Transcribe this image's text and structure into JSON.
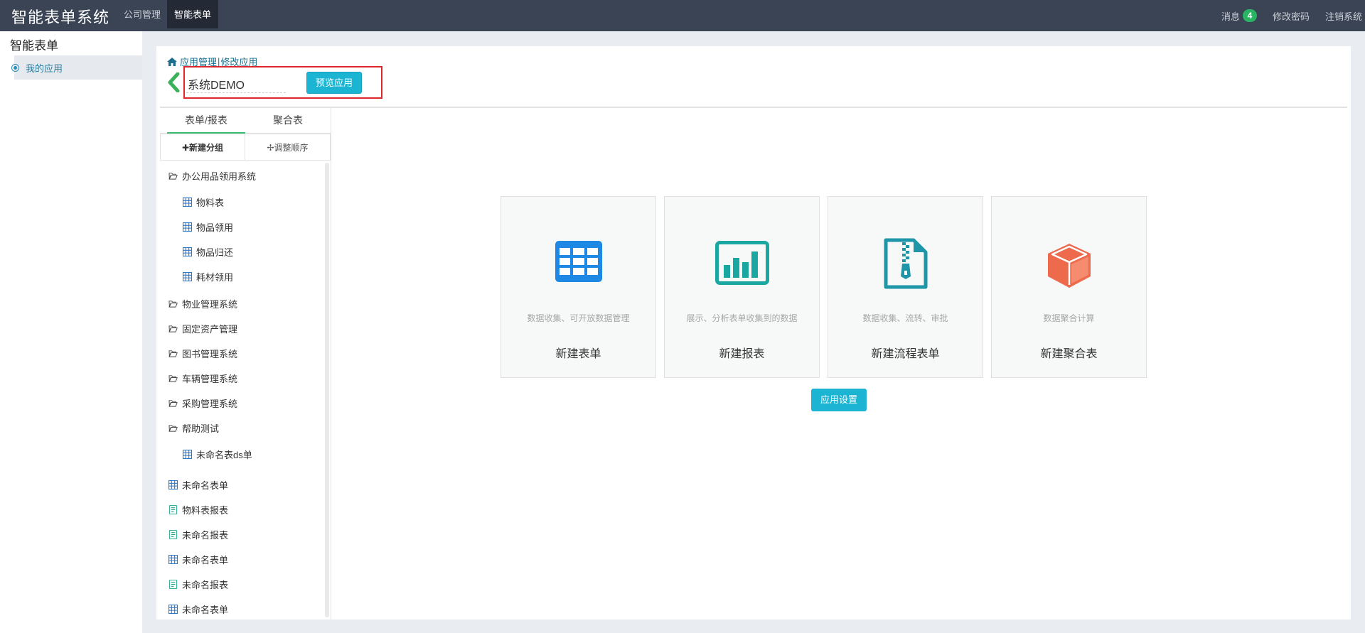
{
  "header": {
    "brand": "智能表单系统",
    "nav": [
      {
        "label": "公司管理"
      },
      {
        "label": "智能表单"
      }
    ],
    "messages_label": "消息",
    "messages_count": "4",
    "change_password": "修改密码",
    "logout": "注销系统"
  },
  "sidebar": {
    "title": "智能表单",
    "items": [
      {
        "label": "我的应用"
      }
    ]
  },
  "breadcrumb": {
    "app_manage": "应用管理",
    "separator": "|",
    "edit_app": "修改应用"
  },
  "app": {
    "name": "系统DEMO",
    "preview_label": "预览应用"
  },
  "tree": {
    "tabs": [
      {
        "label": "表单/报表"
      },
      {
        "label": "聚合表"
      }
    ],
    "new_group": "✚新建分组",
    "reorder": "✢调整顺序",
    "nodes": [
      {
        "label": "办公用品领用系统",
        "icon": "folder-open-icon"
      },
      {
        "label": "物料表",
        "icon": "table-icon"
      },
      {
        "label": "物品领用",
        "icon": "table-icon"
      },
      {
        "label": "物品归还",
        "icon": "table-icon"
      },
      {
        "label": "耗材领用",
        "icon": "table-icon"
      },
      {
        "label": "物业管理系统",
        "icon": "folder-open-icon"
      },
      {
        "label": "固定资产管理",
        "icon": "folder-open-icon"
      },
      {
        "label": "图书管理系统",
        "icon": "folder-open-icon"
      },
      {
        "label": "车辆管理系统",
        "icon": "folder-open-icon"
      },
      {
        "label": "采购管理系统",
        "icon": "folder-open-icon"
      },
      {
        "label": "帮助测试",
        "icon": "folder-open-icon"
      },
      {
        "label": "未命名表ds单",
        "icon": "table-icon"
      },
      {
        "label": "未命名表单",
        "icon": "table-icon"
      },
      {
        "label": "物料表报表",
        "icon": "report-icon"
      },
      {
        "label": "未命名报表",
        "icon": "report-icon"
      },
      {
        "label": "未命名表单",
        "icon": "table-icon"
      },
      {
        "label": "未命名报表",
        "icon": "report-icon"
      },
      {
        "label": "未命名表单",
        "icon": "table-icon"
      }
    ]
  },
  "cards": [
    {
      "desc": "数据收集、可开放数据管理",
      "title": "新建表单",
      "icon": "grid-table-icon",
      "color": "#1e88e5"
    },
    {
      "desc": "展示、分析表单收集到的数据",
      "title": "新建报表",
      "icon": "bar-chart-icon",
      "color": "#1aa7a1"
    },
    {
      "desc": "数据收集、流转、审批",
      "title": "新建流程表单",
      "icon": "zip-file-icon",
      "color": "#1f95a8"
    },
    {
      "desc": "数据聚合计算",
      "title": "新建聚合表",
      "icon": "cube-icon",
      "color": "#ee6a4c"
    }
  ],
  "settings_label": "应用设置"
}
